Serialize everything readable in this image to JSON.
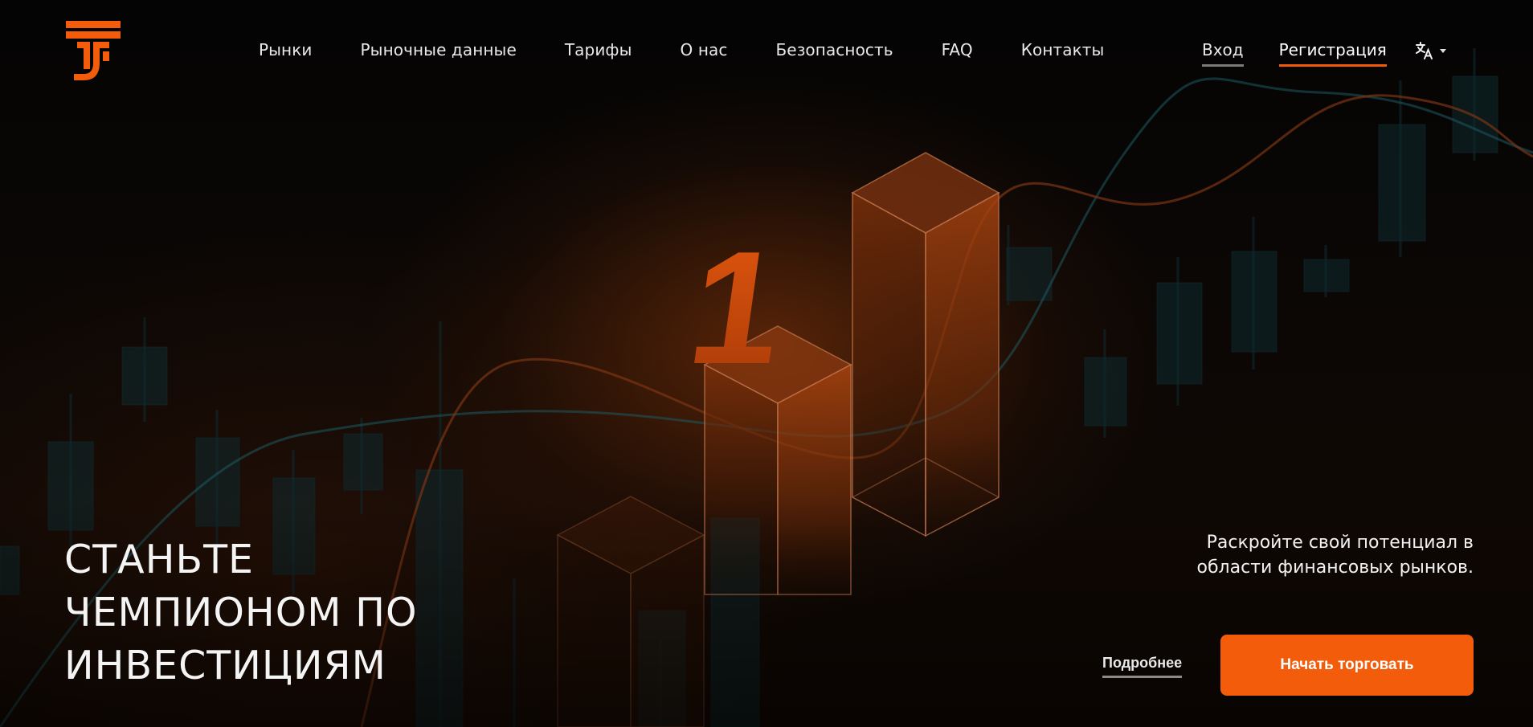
{
  "header": {
    "nav": [
      {
        "label": "Рынки"
      },
      {
        "label": "Рыночные данные"
      },
      {
        "label": "Тарифы"
      },
      {
        "label": "О нас"
      },
      {
        "label": "Безопасность"
      },
      {
        "label": "FAQ"
      },
      {
        "label": "Контакты"
      }
    ],
    "login_label": "Вход",
    "register_label": "Регистрация",
    "language_icon": "translate-icon"
  },
  "hero": {
    "title_lines": [
      "СТАНЬТЕ",
      "ЧЕМПИОНОМ ПО",
      "ИНВЕСТИЦИЯМ"
    ],
    "subtitle_lines": [
      "Раскройте свой потенциал в",
      "области финансовых рынков."
    ],
    "more_label": "Подробнее",
    "cta_label": "Начать торговать",
    "podium_number": "1"
  },
  "colors": {
    "accent": "#f25c0a",
    "background": "#050302",
    "text": "#f2f2f2"
  }
}
